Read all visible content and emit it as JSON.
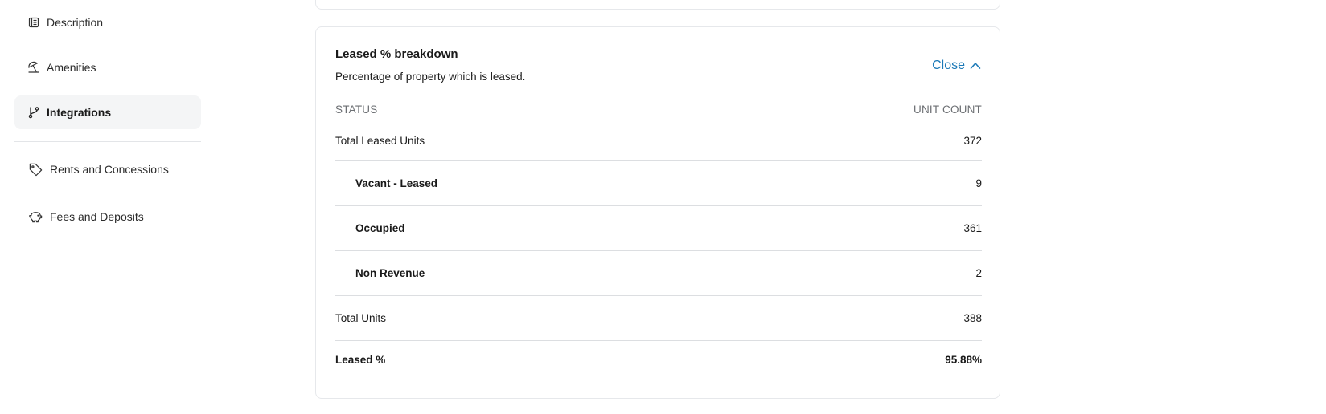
{
  "sidebar": {
    "items": [
      {
        "label": "Description",
        "icon": "document-icon"
      },
      {
        "label": "Amenities",
        "icon": "beach-umbrella-icon"
      },
      {
        "label": "Integrations",
        "icon": "git-branch-icon",
        "active": true
      },
      {
        "label": "Rents and Concessions",
        "icon": "tag-icon"
      },
      {
        "label": "Fees and Deposits",
        "icon": "piggy-bank-icon"
      }
    ]
  },
  "card": {
    "title": "Leased % breakdown",
    "subtitle": "Percentage of property which is leased.",
    "close_label": "Close",
    "accent_color": "#1b79b7",
    "table": {
      "headers": {
        "status": "STATUS",
        "unit_count": "UNIT COUNT"
      },
      "rows": [
        {
          "label": "Total Leased Units",
          "value": "372"
        },
        {
          "label": "Vacant - Leased",
          "value": "9"
        },
        {
          "label": "Occupied",
          "value": "361"
        },
        {
          "label": "Non Revenue",
          "value": "2"
        },
        {
          "label": "Total Units",
          "value": "388"
        },
        {
          "label": "Leased %",
          "value": "95.88%"
        }
      ]
    }
  }
}
